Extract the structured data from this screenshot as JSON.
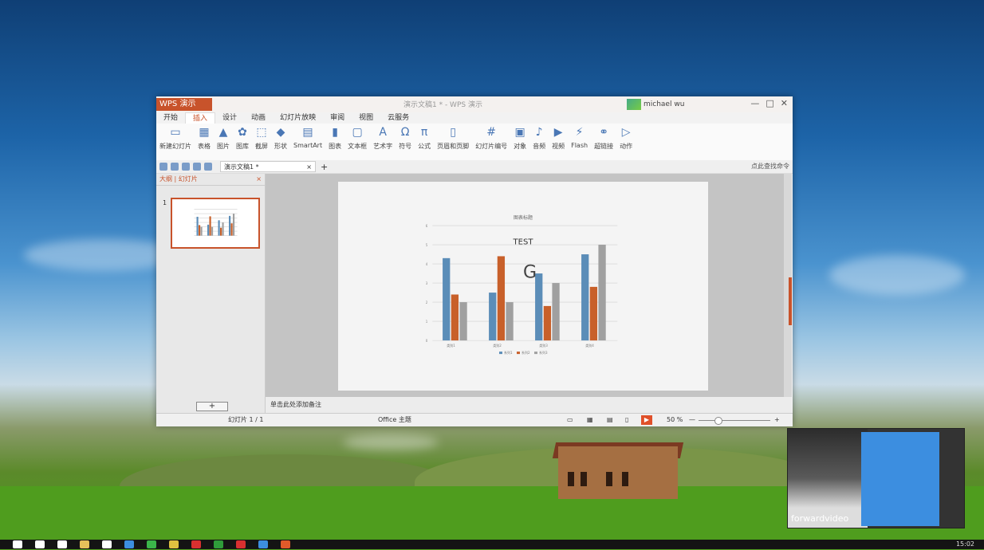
{
  "window": {
    "app_label": "WPS 演示",
    "doc_title": "演示文稿1 * - WPS 演示",
    "user_name": "michael wu",
    "controls": [
      "—",
      "□",
      "✕"
    ]
  },
  "menus": [
    "开始",
    "插入",
    "设计",
    "动画",
    "幻灯片放映",
    "审阅",
    "视图",
    "云服务"
  ],
  "active_menu_index": 1,
  "ribbon": [
    {
      "icon": "new-slide-icon",
      "glyph": "▭",
      "label": "新建幻灯片"
    },
    {
      "icon": "table-icon",
      "glyph": "▦",
      "label": "表格"
    },
    {
      "icon": "picture-icon",
      "glyph": "▲",
      "label": "图片"
    },
    {
      "icon": "gallery-icon",
      "glyph": "✿",
      "label": "图库"
    },
    {
      "icon": "screenshot-icon",
      "glyph": "⬚",
      "label": "截屏"
    },
    {
      "icon": "shape-icon",
      "glyph": "◆",
      "label": "形状"
    },
    {
      "icon": "smartart-icon",
      "glyph": "▤",
      "label": "SmartArt"
    },
    {
      "icon": "chart-icon",
      "glyph": "▮",
      "label": "图表"
    },
    {
      "icon": "textbox-icon",
      "glyph": "▢",
      "label": "文本框"
    },
    {
      "icon": "wordart-icon",
      "glyph": "A",
      "label": "艺术字"
    },
    {
      "icon": "symbol-icon",
      "glyph": "Ω",
      "label": "符号"
    },
    {
      "icon": "formula-icon",
      "glyph": "π",
      "label": "公式"
    },
    {
      "icon": "header-footer-icon",
      "glyph": "▯",
      "label": "页眉和页脚"
    },
    {
      "icon": "slide-number-icon",
      "glyph": "#",
      "label": "幻灯片编号"
    },
    {
      "icon": "object-icon",
      "glyph": "▣",
      "label": "对象"
    },
    {
      "icon": "audio-icon",
      "glyph": "♪",
      "label": "音频"
    },
    {
      "icon": "video-icon",
      "glyph": "▶",
      "label": "视频"
    },
    {
      "icon": "flash-icon",
      "glyph": "⚡",
      "label": "Flash"
    },
    {
      "icon": "hyperlink-icon",
      "glyph": "⚭",
      "label": "超链接"
    },
    {
      "icon": "action-icon",
      "glyph": "▷",
      "label": "动作"
    }
  ],
  "quick_access": {
    "doc_tab": "演示文稿1 *",
    "tab_close": "×",
    "tab_add": "+",
    "search_hint": "点此查找命令"
  },
  "left_panel": {
    "tabs": "大纲 | 幻灯片",
    "close": "×",
    "slide_number": "1",
    "add_button": "+"
  },
  "notes_placeholder": "单击此处添加备注",
  "status": {
    "slide_counter": "幻灯片 1 / 1",
    "theme": "Office 主题",
    "zoom": "50 %",
    "zoom_minus": "—",
    "zoom_plus": "+"
  },
  "chart_data": {
    "type": "bar",
    "title": "TEST",
    "subtitle": "图表标题",
    "categories": [
      "类别1",
      "类别2",
      "类别3",
      "类别4"
    ],
    "series": [
      {
        "name": "系列1",
        "values": [
          4.3,
          2.5,
          3.5,
          4.5
        ],
        "color": "#5b8db8"
      },
      {
        "name": "系列2",
        "values": [
          2.4,
          4.4,
          1.8,
          2.8
        ],
        "color": "#c8602a"
      },
      {
        "name": "系列3",
        "values": [
          2.0,
          2.0,
          3.0,
          5.0
        ],
        "color": "#a0a0a0"
      }
    ],
    "ylim": [
      0,
      6
    ],
    "yticks": [
      0,
      1,
      2,
      3,
      4,
      5,
      6
    ],
    "legend": "bottom",
    "annotation": "G"
  },
  "video_overlay": {
    "label": "forwardvideo"
  },
  "taskbar": {
    "clock": "15:02",
    "icons": [
      {
        "name": "windows-start-icon",
        "color": "#ffffff"
      },
      {
        "name": "search-icon",
        "color": "#ffffff"
      },
      {
        "name": "task-view-icon",
        "color": "#ffffff"
      },
      {
        "name": "explorer-icon",
        "color": "#e6c05a"
      },
      {
        "name": "store-icon",
        "color": "#ffffff"
      },
      {
        "name": "edge-icon",
        "color": "#3c8ee0"
      },
      {
        "name": "media-icon",
        "color": "#3bb54a"
      },
      {
        "name": "chrome-icon",
        "color": "#e0c040"
      },
      {
        "name": "app-red-icon",
        "color": "#d83030"
      },
      {
        "name": "sheet-icon",
        "color": "#2f9c3a"
      },
      {
        "name": "pdf-icon",
        "color": "#d83030"
      },
      {
        "name": "word-icon",
        "color": "#3c8ee0"
      },
      {
        "name": "wps-icon",
        "color": "#e05a2a"
      }
    ]
  }
}
